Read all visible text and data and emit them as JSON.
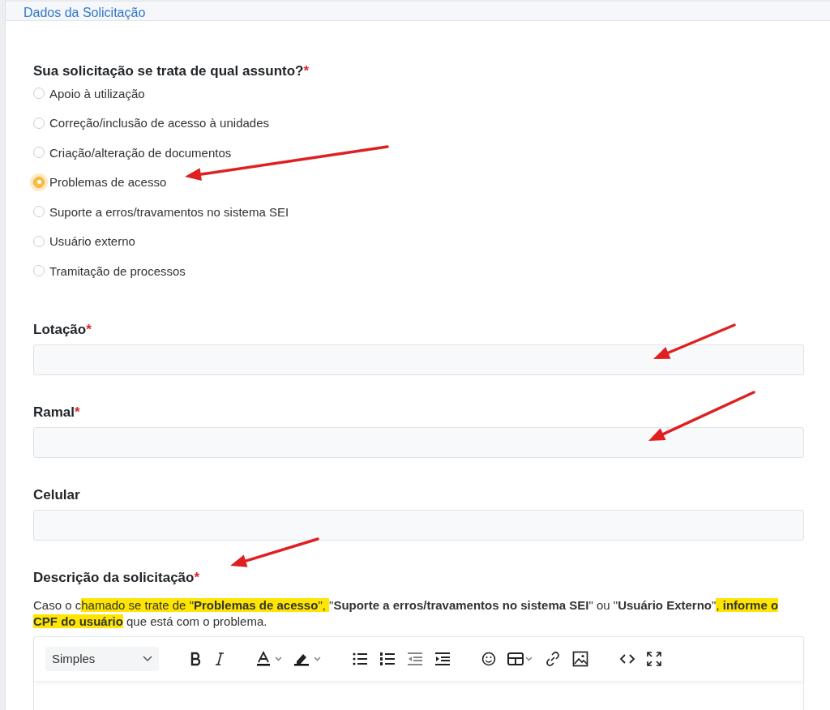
{
  "section": {
    "title": "Dados da Solicitação"
  },
  "question": {
    "label": "Sua solicitação se trata de qual assunto?",
    "required_mark": "*",
    "options": [
      {
        "label": "Apoio à utilização",
        "selected": false
      },
      {
        "label": "Correção/inclusão de acesso à unidades",
        "selected": false
      },
      {
        "label": "Criação/alteração de documentos",
        "selected": false
      },
      {
        "label": "Problemas de acesso",
        "selected": true
      },
      {
        "label": "Suporte a erros/travamentos no sistema SEI",
        "selected": false
      },
      {
        "label": "Usuário externo",
        "selected": false
      },
      {
        "label": "Tramitação de processos",
        "selected": false
      }
    ]
  },
  "fields": [
    {
      "label": "Lotação",
      "required_mark": "*"
    },
    {
      "label": "Ramal",
      "required_mark": "*"
    },
    {
      "label": "Celular"
    }
  ],
  "description": {
    "label": "Descrição da solicitação",
    "required_mark": "*",
    "help": [
      {
        "text": "Caso o c",
        "bold": false,
        "highlighted": false
      },
      {
        "text": "hamado se trate de ",
        "bold": false,
        "highlighted": true
      },
      {
        "text": "\"",
        "bold": false,
        "highlighted": true
      },
      {
        "text": "Problemas de acesso",
        "bold": true,
        "highlighted": true
      },
      {
        "text": "\", ",
        "bold": false,
        "highlighted": true
      },
      {
        "text": "\"",
        "bold": false,
        "highlighted": false
      },
      {
        "text": "Suporte a erros/travamentos no sistema SEI",
        "bold": true,
        "highlighted": false
      },
      {
        "text": "\" ou \"",
        "bold": false,
        "highlighted": false
      },
      {
        "text": "Usuário Externo",
        "bold": true,
        "highlighted": false
      },
      {
        "text": "\"",
        "bold": false,
        "highlighted": false
      },
      {
        "text": ", ",
        "bold": false,
        "highlighted": true
      },
      {
        "text": "informe o CPF do usuário",
        "bold": true,
        "highlighted": true
      },
      {
        "text": " que está com o problema.",
        "bold": false,
        "highlighted": false
      }
    ],
    "editor": {
      "format": "Simples"
    }
  },
  "annotations": [
    {
      "kind": "arrow"
    },
    {
      "kind": "arrow"
    },
    {
      "kind": "arrow"
    },
    {
      "kind": "arrow"
    }
  ]
}
